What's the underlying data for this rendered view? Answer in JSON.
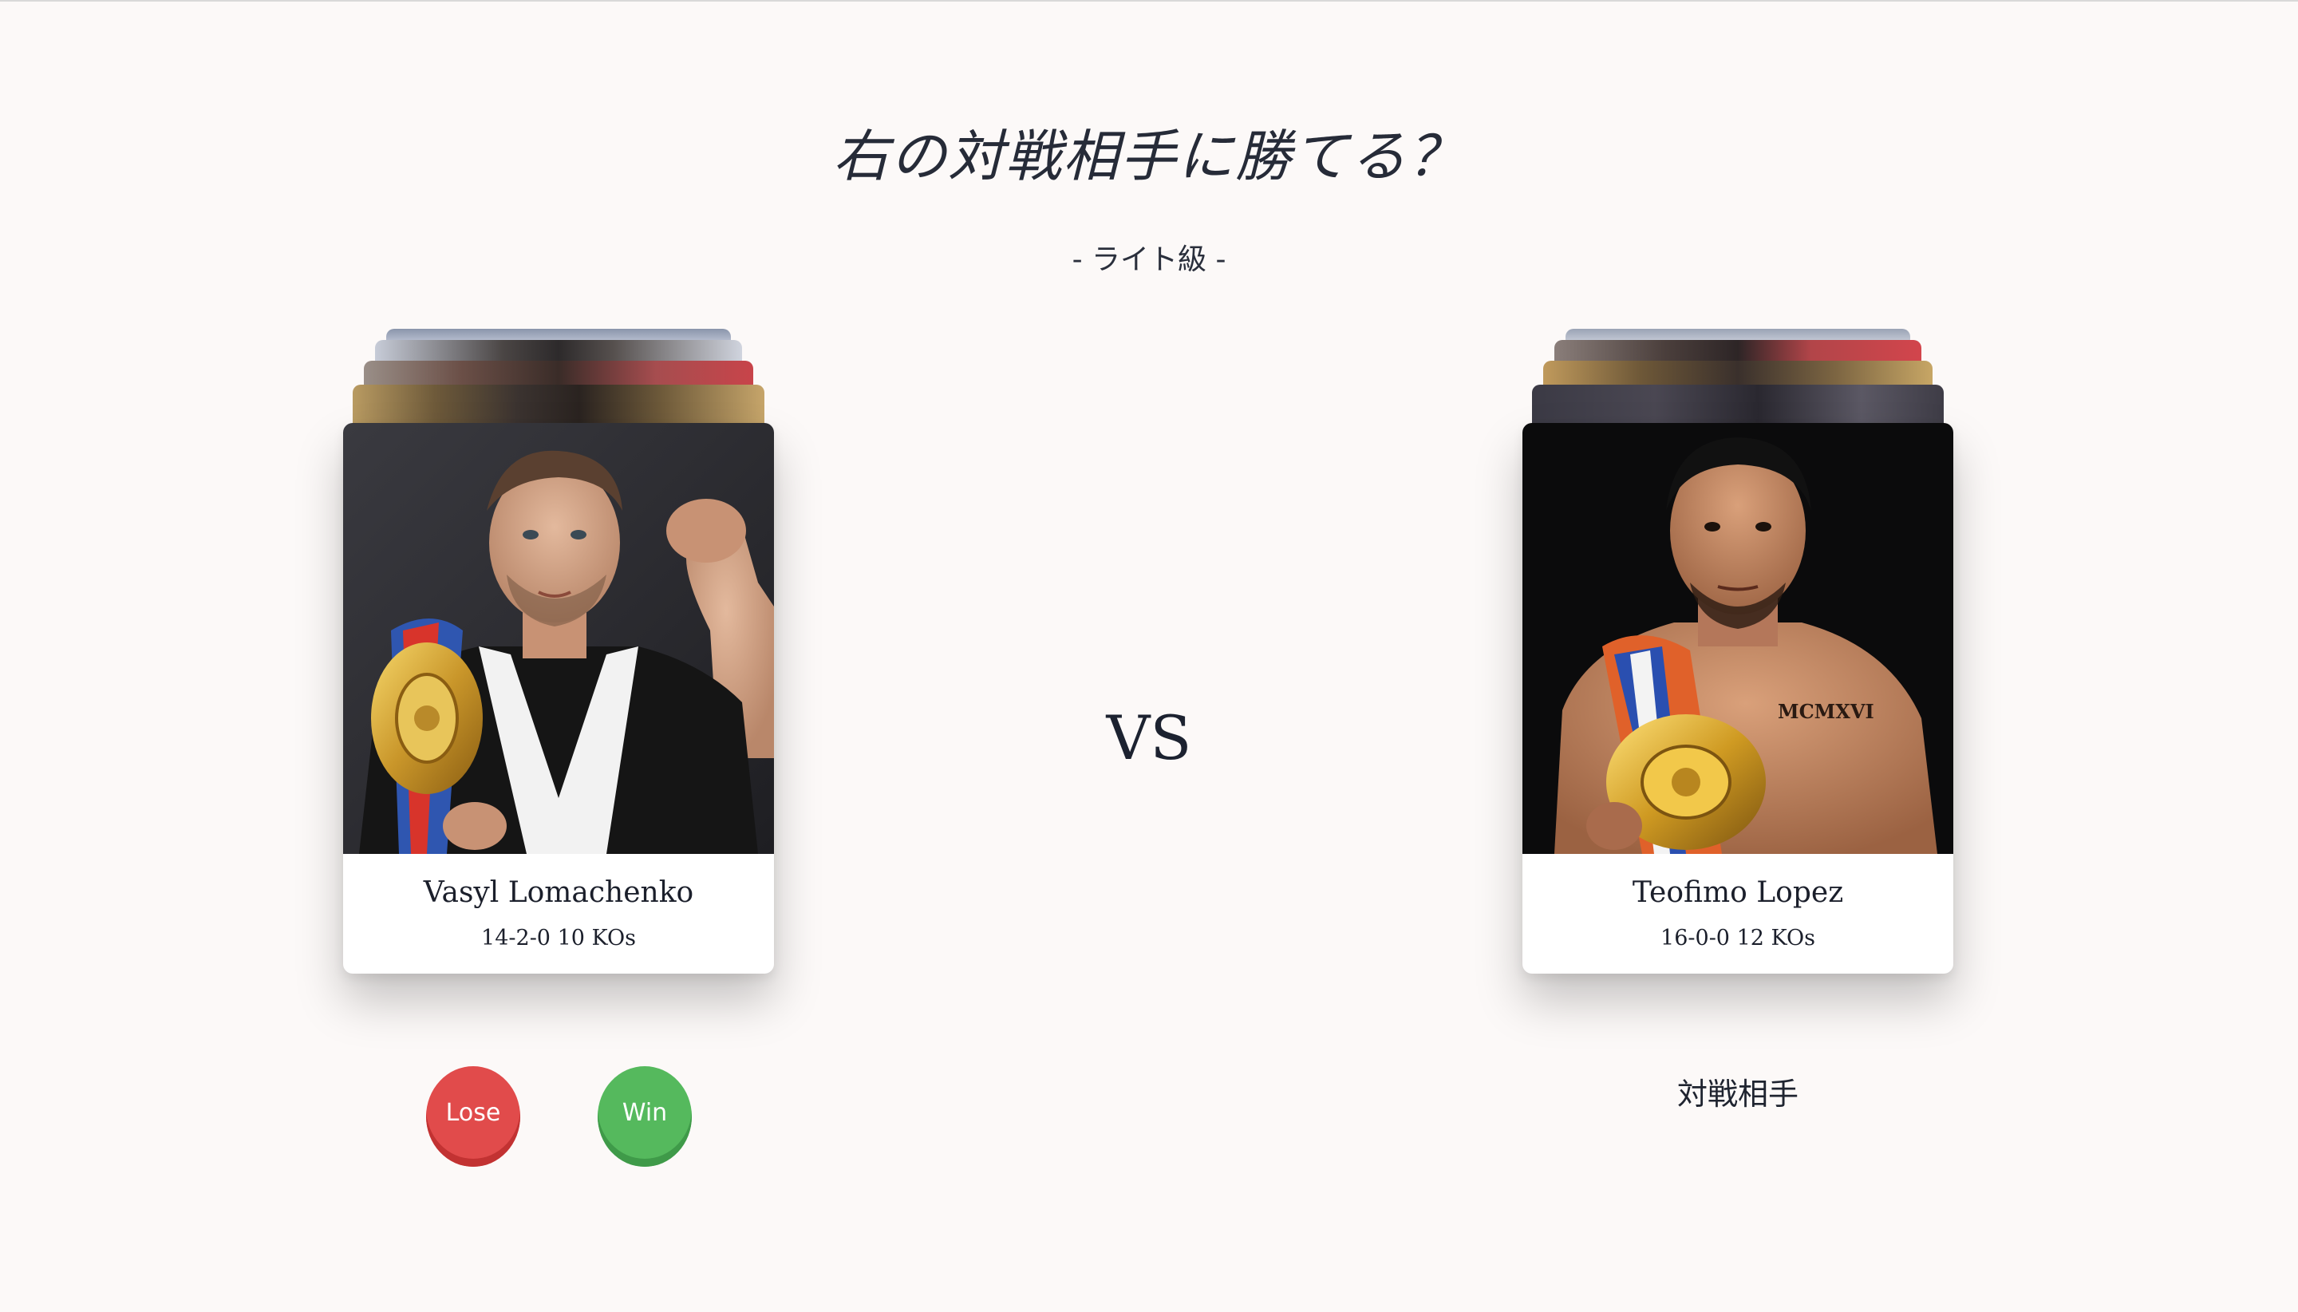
{
  "page": {
    "title": "右の対戦相手に勝てる？",
    "weight_class": "- ライト級 -",
    "vs_label": "VS"
  },
  "fighters": [
    {
      "name": "Vasyl Lomachenko",
      "record": "14-2-0 10 KOs",
      "photo": "fighter-photo-with-championship-belt"
    },
    {
      "name": "Teofimo Lopez",
      "record": "16-0-0 12 KOs",
      "photo": "fighter-photo-with-championship-belt",
      "tattoo_text": "MCMXVI"
    }
  ],
  "actions": {
    "lose_label": "Lose",
    "win_label": "Win",
    "lose_color": "#e14b4b",
    "win_color": "#55b95d"
  },
  "opponent_label": "対戦相手"
}
